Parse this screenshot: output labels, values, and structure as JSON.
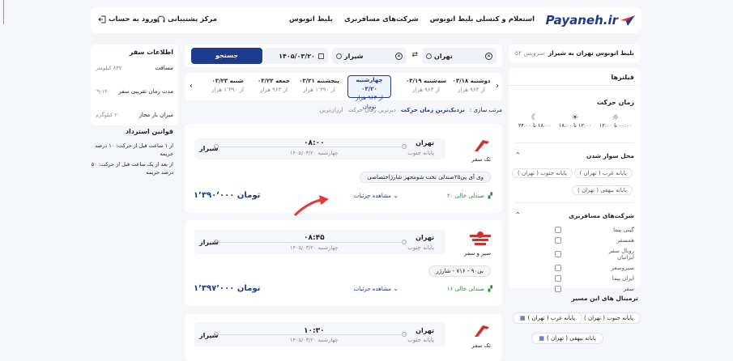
{
  "header": {
    "logo_text": "Payaneh.ir",
    "nav": [
      "بلیط اتوبوس",
      "شرکت‌های مسافربری",
      "استعلام و کنسلی بلیط اتوبوس"
    ],
    "support": "مرکز پشتیبانی",
    "login": "ورود به حساب"
  },
  "route_bar": {
    "title": "بلیط اتوبوس تهران به شیراز",
    "count": "۵۲ سرویس",
    "origin": "تهران",
    "destination": "شیراز",
    "date": "۱۴۰۵/۰۳/۲۰",
    "search": "جستجو"
  },
  "filters": {
    "title": "فیلترها",
    "time_title": "زمان حرکت",
    "times": [
      "۰۰:۰۰ تا ۱۲:۰۰",
      "۱۲:۰۰ تا ۱۸:۰۰",
      "۱۸:۰۰ تا ۲۴:۰۰"
    ],
    "boarding_title": "محل سوار شدن",
    "boarding": [
      "پایانه غرب ( تهران )",
      "پایانه جنوب ( تهران )",
      "پایانه بیهقی ( تهران )"
    ],
    "companies_title": "شرکت‌های مسافربری",
    "companies": [
      "گیتی پیما",
      "همسفر",
      "رویال سفر ایرانیان",
      "سیروسفر",
      "ایران پیما",
      "سفر"
    ],
    "terminals_title": "ترمینال های این مسیر",
    "terminals": [
      "پایانه جنوب ( تهران )",
      "پایانه غرب ( تهران )",
      "پایانه بیهقی ( تهران )"
    ]
  },
  "dates": [
    {
      "day": "دوشنبه ۰۳/۱۸",
      "price": "از ۹۶۴ هزار"
    },
    {
      "day": "سه‌شنبه ۰۳/۱۹",
      "price": "از ۹۶۳ هزار"
    },
    {
      "day": "چهارشنبه ۰۳/۲۰",
      "price": "از ۹۶۳ هزار تومان"
    },
    {
      "day": "پنجشنبه ۰۳/۲۱",
      "price": "از ۱٬۳۹۰ هزار"
    },
    {
      "day": "جمعه ۰۳/۲۲",
      "price": "از ۹۶۳ هزار"
    },
    {
      "day": "شنبه ۰۳/۲۳",
      "price": "از ۱٬۳۹۰ هزار"
    }
  ],
  "dates_unit": "تومان",
  "sort": {
    "label": "مرتب سازی :",
    "options": [
      "نزدیک‌ترین زمان حرکت",
      "دیرترین زمان حرکت",
      "ارزان‌ترین"
    ]
  },
  "trips": [
    {
      "company": "تک سفر",
      "origin": "تهران",
      "origin_terminal": "پایانه جنوب",
      "dest": "شیراز",
      "time": "۰۸:۰۰",
      "date": "چهارشنبه ۱۴۰۵/۰۳/۲۰",
      "bus": "وی آی پی۲۵صندلی تخت شومجهز شارژاختصاصی",
      "seats": "۲۰ صندلی خالی",
      "details": "مشاهده جزئیات",
      "price": "۱٬۳۹۰٬۰۰۰ تومان"
    },
    {
      "company": "سیر و سفر",
      "origin": "تهران",
      "origin_terminal": "پایانه جنوب",
      "dest": "شیراز",
      "time": "۰۸:۴۵",
      "date": "چهارشنبه ۱۴۰۵/۰۳/۲۰",
      "bus": "بی۹۰ - ۷۱۶ - شارژر",
      "seats": "۱۶ صندلی خالی",
      "details": "مشاهده جزئیات",
      "price": "۱٬۳۹۷٬۰۰۰ تومان"
    },
    {
      "company": "تک سفر",
      "origin": "تهران",
      "origin_terminal": "پایانه جنوب",
      "dest": "شیراز",
      "time": "۱۰:۳۰",
      "date": "چهارشنبه ۱۴۰۵/۰۳/۲۰"
    }
  ],
  "trip_info": {
    "title": "اطلاعات سفر",
    "rows": [
      {
        "label": "مسافت",
        "value": "۸۳۷ کیلومتر"
      },
      {
        "label": "مدت زمان تقریبی سفر",
        "value": "۹:۱۴'"
      },
      {
        "label": "میزان بار مجاز",
        "value": "۲۰ کیلوگرم"
      }
    ]
  },
  "refund": {
    "title": "قوانین استرداد",
    "rules": [
      "از ۱ ساعت قبل از حرکت: ۱۰ درصد جریمه",
      "از بعد از یک ساعت قبل از حرکت: ۵۰ درصد جریمه"
    ]
  },
  "colors": {
    "brand": "#1e3a8a",
    "accent": "#e53935",
    "green": "#2e8b3a"
  }
}
